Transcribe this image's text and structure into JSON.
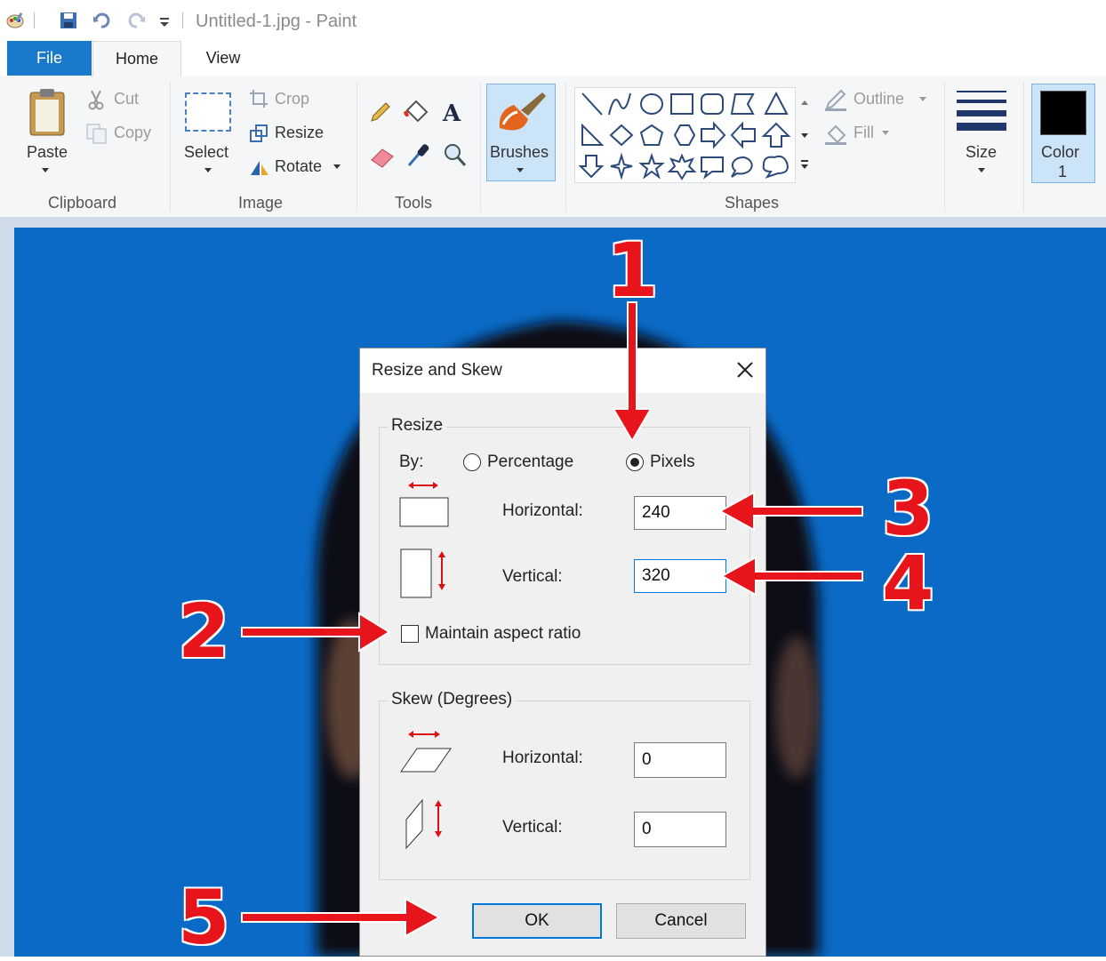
{
  "window": {
    "title": "Untitled-1.jpg - Paint"
  },
  "tabs": {
    "file": "File",
    "home": "Home",
    "view": "View"
  },
  "ribbon": {
    "clipboard": {
      "paste": "Paste",
      "cut": "Cut",
      "copy": "Copy",
      "label": "Clipboard"
    },
    "image": {
      "select": "Select",
      "crop": "Crop",
      "resize": "Resize",
      "rotate": "Rotate",
      "label": "Image"
    },
    "tools": {
      "label": "Tools"
    },
    "brushes": {
      "label": "Brushes"
    },
    "shapes": {
      "outline": "Outline",
      "fill": "Fill",
      "label": "Shapes"
    },
    "size": {
      "label": "Size"
    },
    "color": {
      "label": "Color",
      "number": "1",
      "value": "#000000"
    }
  },
  "dialog": {
    "title": "Resize and Skew",
    "resize": {
      "legend": "Resize",
      "by_label": "By:",
      "percentage_label": "Percentage",
      "pixels_label": "Pixels",
      "selected": "Pixels",
      "horizontal_label": "Horizontal:",
      "horizontal_value": "240",
      "vertical_label": "Vertical:",
      "vertical_value": "320",
      "maintain_aspect_label": "Maintain aspect ratio",
      "maintain_aspect_checked": false
    },
    "skew": {
      "legend": "Skew (Degrees)",
      "horizontal_label": "Horizontal:",
      "horizontal_value": "0",
      "vertical_label": "Vertical:",
      "vertical_value": "0"
    },
    "ok_label": "OK",
    "cancel_label": "Cancel"
  },
  "annotations": {
    "n1": "1",
    "n2": "2",
    "n3": "3",
    "n4": "4",
    "n5": "5"
  },
  "colors": {
    "file_tab": "#1979ca",
    "photo_bg": "#0a6ac5",
    "annotation": "#e8141b",
    "focus": "#0078d7"
  }
}
